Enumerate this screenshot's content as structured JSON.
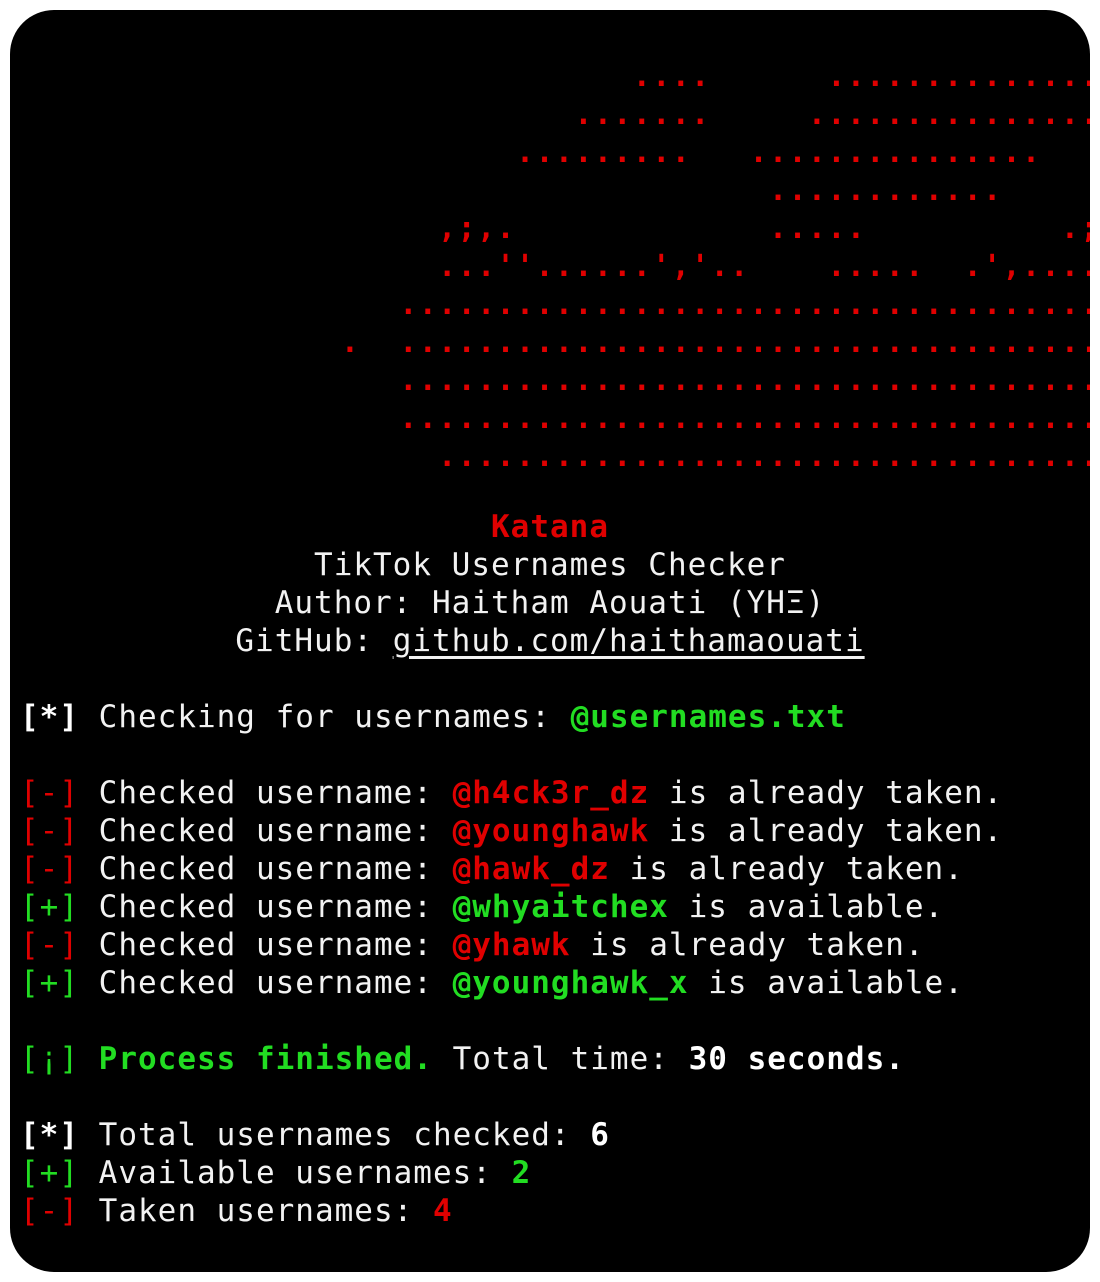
{
  "colors": {
    "background": "#000000",
    "text": "#f2f2f2",
    "red": "#e00000",
    "green": "#22dd22"
  },
  "ascii_art": [
    "                                ....      ...............",
    "                             .......     ................",
    "                          .........   ...............",
    "                                       ............           .",
    "                      ,;,.             .....          .;;;  .",
    "                      ...''......','..    .....  .',.....',,'.",
    "                    ..................................... .",
    "                 .  .......................................",
    "                    ......................................",
    "                    ......................................",
    "                      ....................................."
  ],
  "banner": {
    "name": "Katana",
    "subtitle": "TikTok Usernames Checker",
    "author": "Author: Haitham Aouati (YHΞ)",
    "github_label": "GitHub: ",
    "github_link": "github.com/haithamaouati"
  },
  "checking": {
    "prefix": "[*]",
    "text": " Checking for usernames: ",
    "file": "@usernames.txt"
  },
  "results": [
    {
      "prefix": "[-]",
      "text": " Checked username: ",
      "username": "@h4ck3r_dz",
      "status": " is already taken.",
      "available": false
    },
    {
      "prefix": "[-]",
      "text": " Checked username: ",
      "username": "@younghawk",
      "status": " is already taken.",
      "available": false
    },
    {
      "prefix": "[-]",
      "text": " Checked username: ",
      "username": "@hawk_dz",
      "status": " is already taken.",
      "available": false
    },
    {
      "prefix": "[+]",
      "text": " Checked username: ",
      "username": "@whyaitchex",
      "status": " is available.",
      "available": true
    },
    {
      "prefix": "[-]",
      "text": " Checked username: ",
      "username": "@yhawk",
      "status": " is already taken.",
      "available": false
    },
    {
      "prefix": "[+]",
      "text": " Checked username: ",
      "username": "@younghawk_x",
      "status": " is available.",
      "available": true
    }
  ],
  "finished": {
    "prefix": "[¡]",
    "message": " Process finished.",
    "label": " Total time: ",
    "value": "30 seconds."
  },
  "summary": {
    "total": {
      "prefix": "[*]",
      "label": " Total usernames checked: ",
      "value": "6"
    },
    "available": {
      "prefix": "[+]",
      "label": " Available usernames: ",
      "value": "2"
    },
    "taken": {
      "prefix": "[-]",
      "label": " Taken usernames: ",
      "value": "4"
    }
  }
}
